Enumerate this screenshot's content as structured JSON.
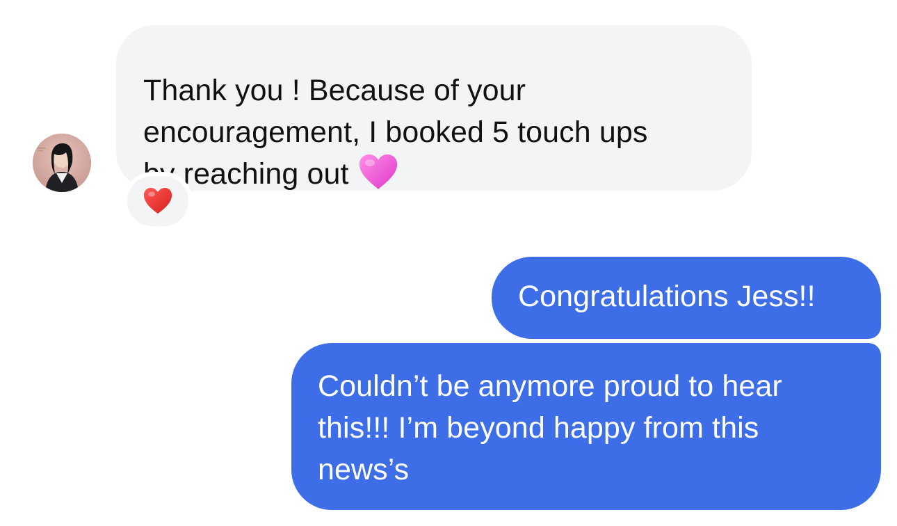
{
  "conversation": {
    "incoming_message": {
      "lines": [
        "Thank you ! Because of your",
        "encouragement, I booked 5 touch ups",
        "by reaching out"
      ],
      "inline_emoji": "pink-heart-icon",
      "reaction": "red-heart-icon"
    },
    "outgoing_messages": [
      {
        "lines": [
          "Congratulations Jess!!"
        ]
      },
      {
        "lines": [
          "Couldn’t be anymore proud to hear",
          "this!!! I’m beyond happy from this",
          "news’s"
        ]
      }
    ]
  },
  "colors": {
    "incoming_bubble": "#f2f4f6",
    "outgoing_bubble": "#3d6ee8",
    "incoming_text": "#111111",
    "outgoing_text": "#ffffff",
    "pink_heart": "#ec5bd7",
    "red_heart": "#e42322"
  }
}
